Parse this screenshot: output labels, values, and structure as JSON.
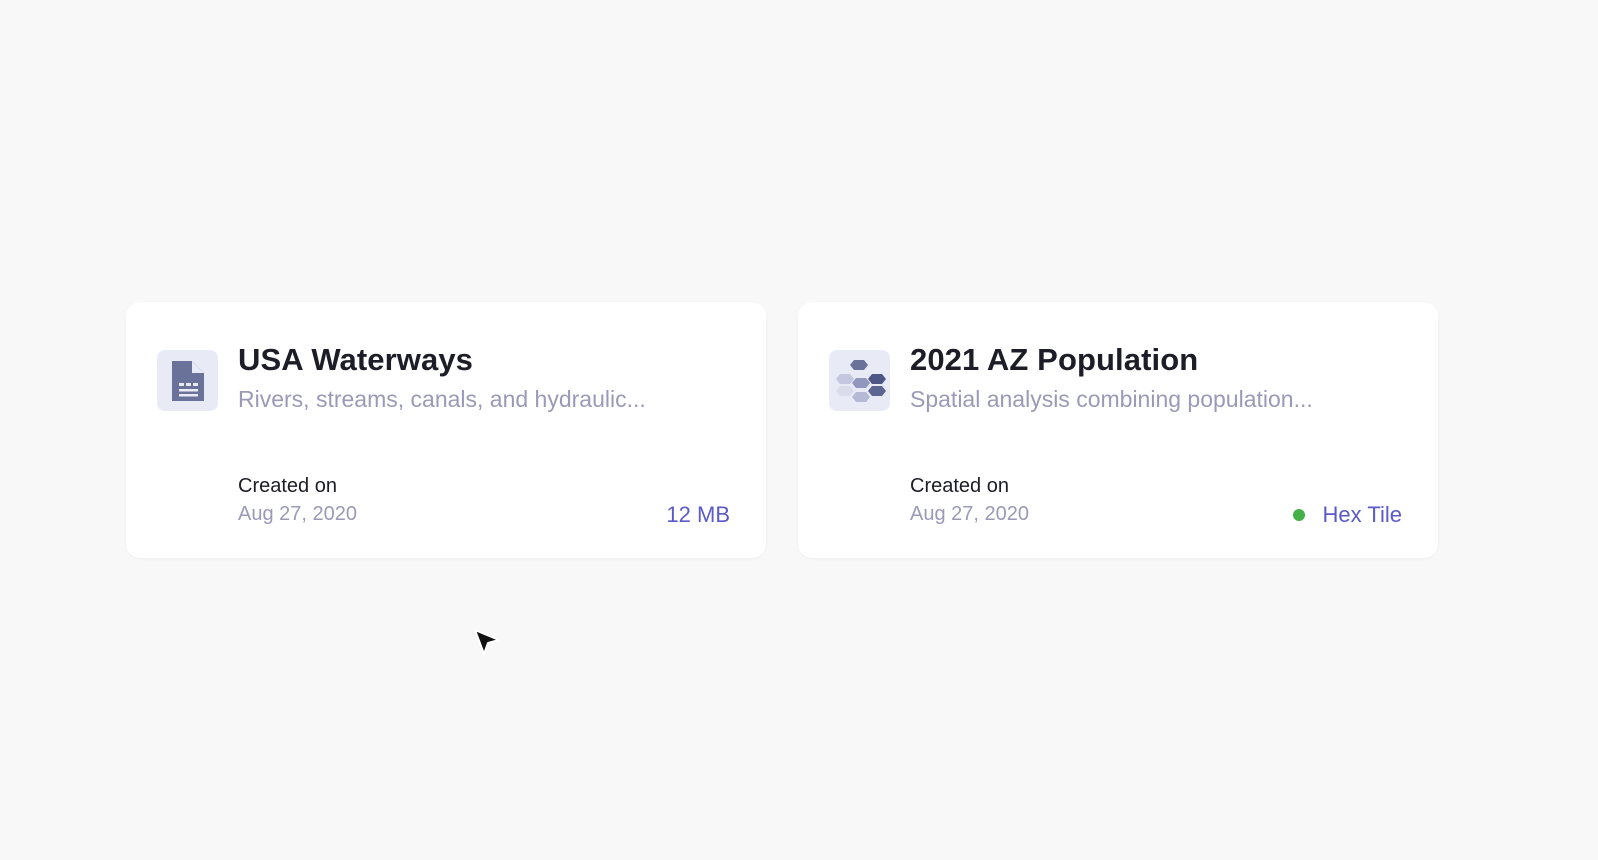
{
  "cards": [
    {
      "title": "USA Waterways",
      "description": "Rivers, streams, canals, and hydraulic...",
      "created_label": "Created on",
      "created_date": "Aug 27, 2020",
      "meta": "12 MB",
      "icon": "document-icon"
    },
    {
      "title": "2021 AZ Population",
      "description": "Spatial analysis combining population...",
      "created_label": "Created on",
      "created_date": "Aug 27, 2020",
      "meta": "Hex Tile",
      "status_color": "#44b048",
      "icon": "hex-tile-icon"
    }
  ],
  "colors": {
    "background": "#f8f8f8",
    "card": "#ffffff",
    "title": "#1c1d26",
    "muted": "#9a9ab8",
    "accent": "#5a5ac8",
    "icon_bg": "#e8eaf6",
    "icon_fg": "#6b7299"
  },
  "cursor": "arrow-cursor-icon"
}
